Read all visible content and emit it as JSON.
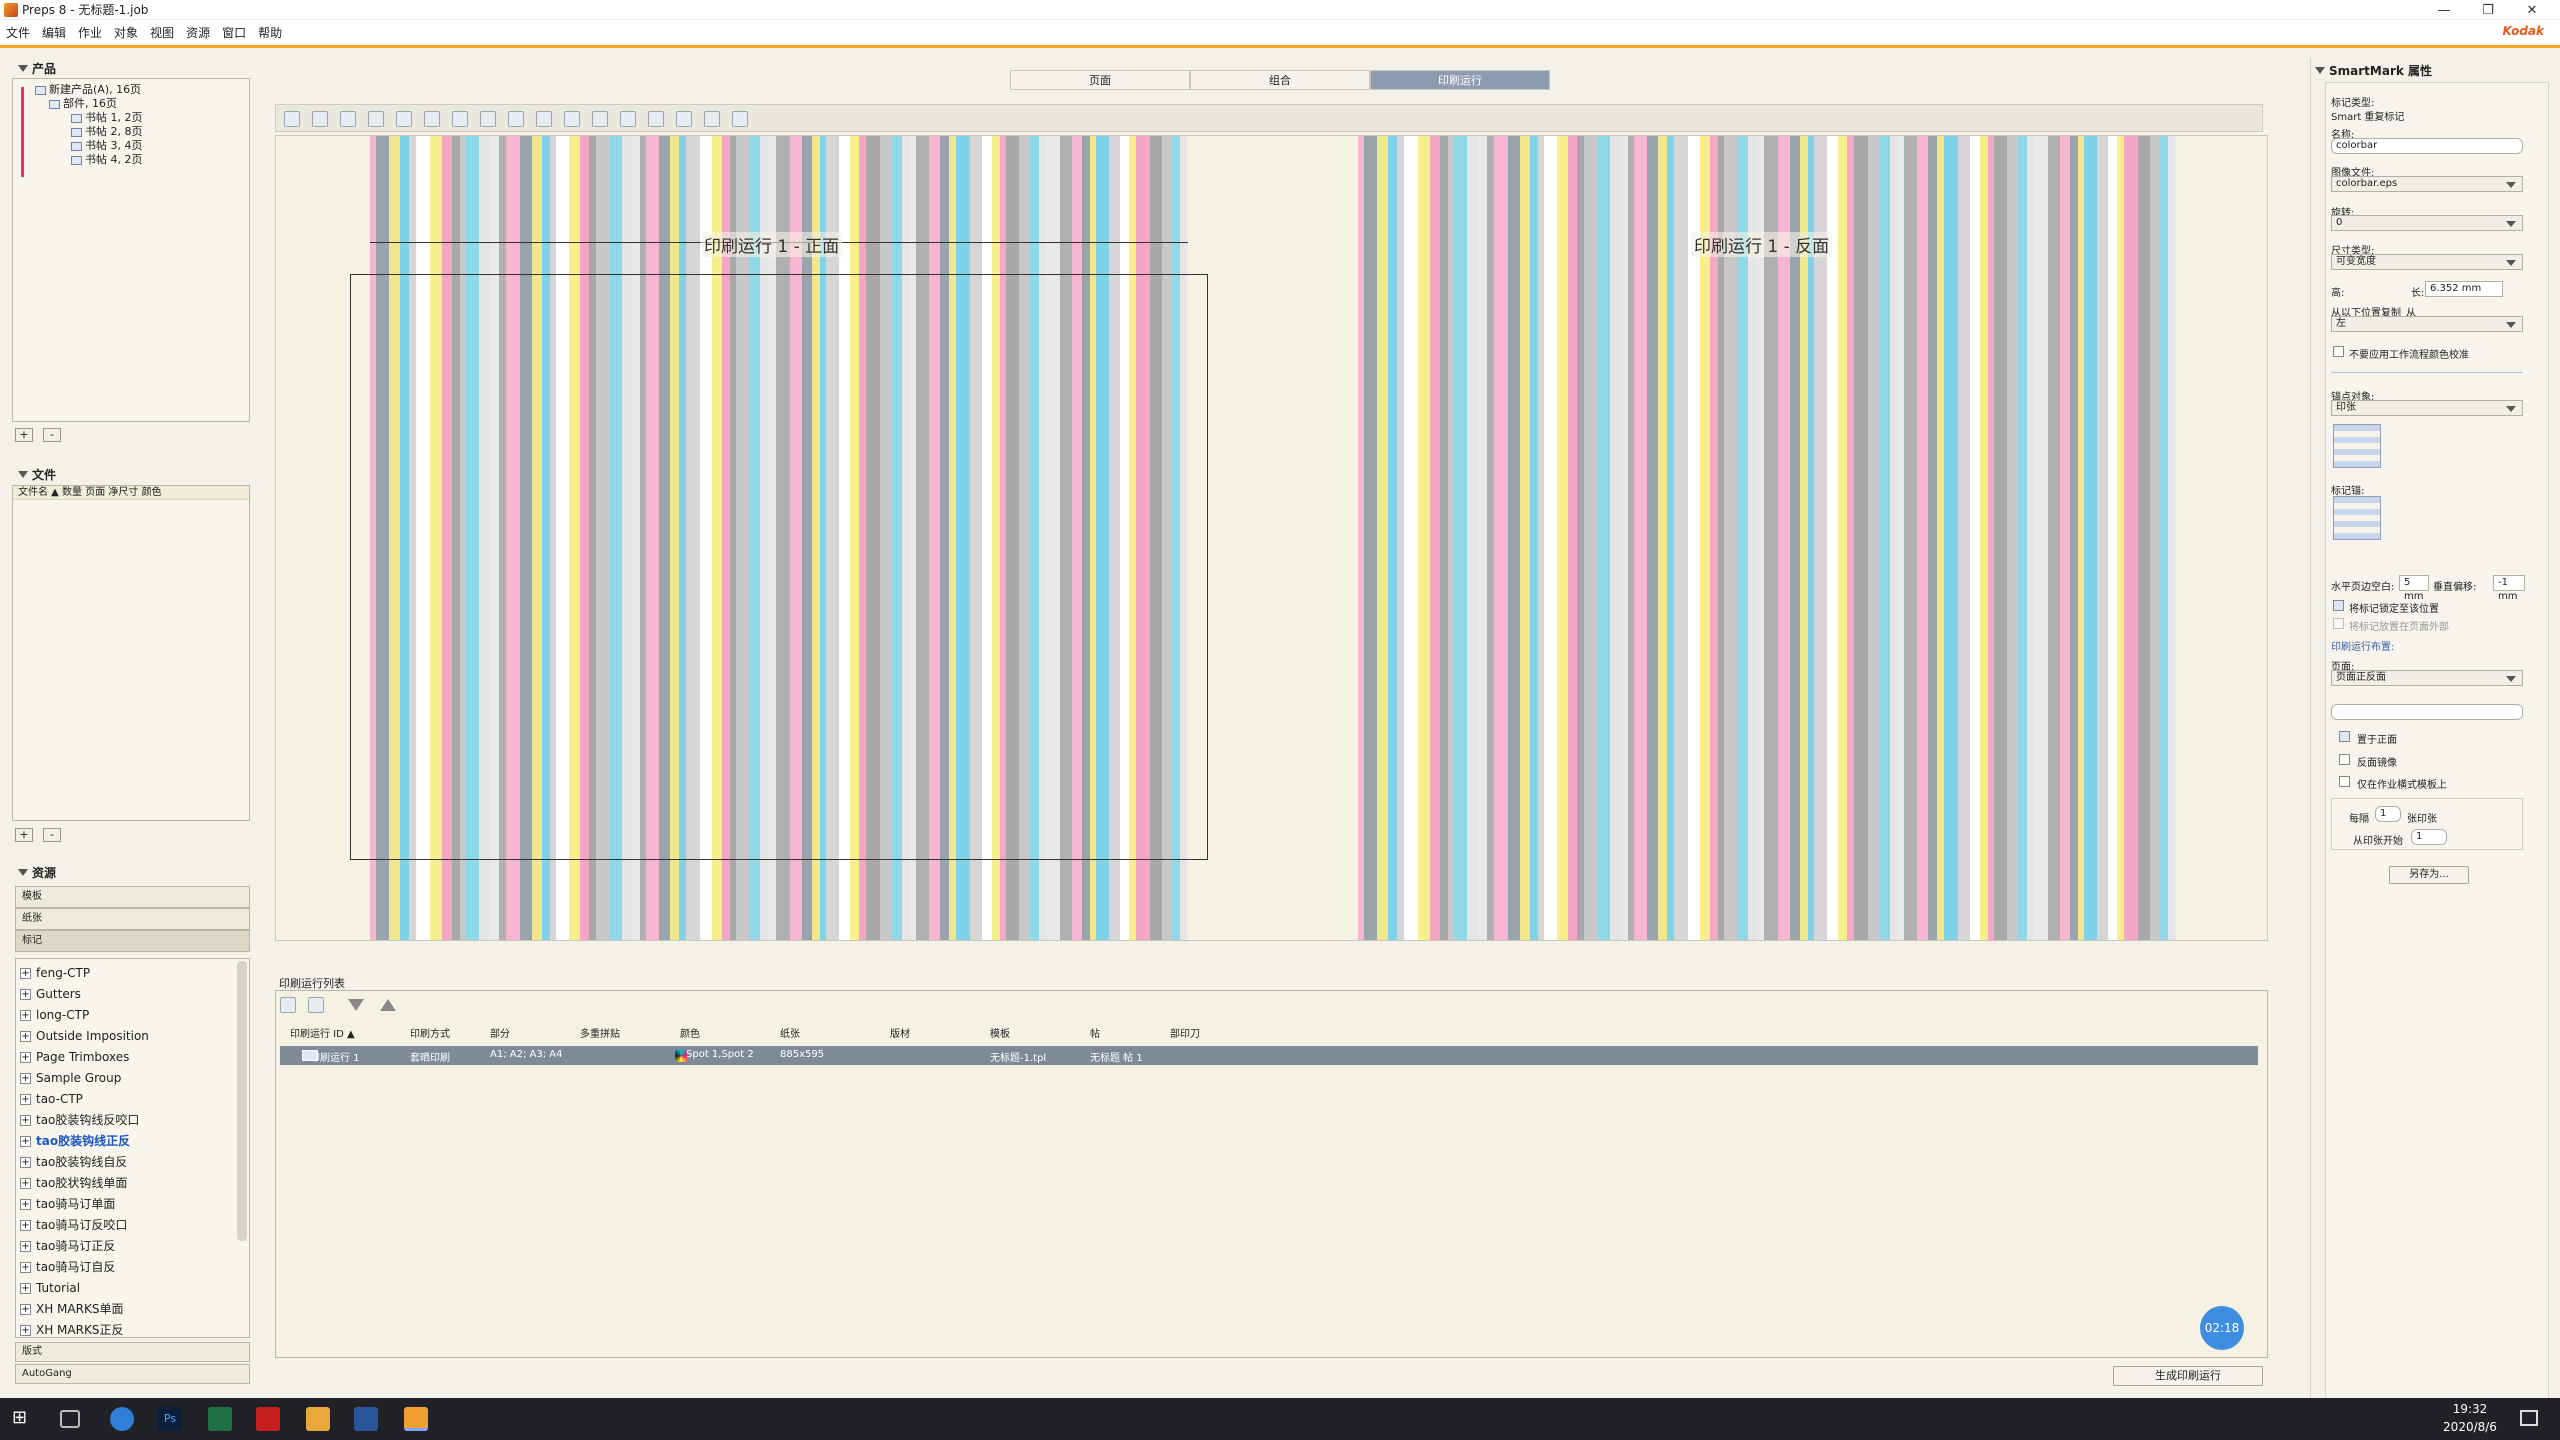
{
  "window": {
    "title": "Preps 8 - 无标题-1.job",
    "brand": "Kodak"
  },
  "menu": [
    "文件",
    "编辑",
    "作业",
    "对象",
    "视图",
    "资源",
    "窗口",
    "帮助"
  ],
  "products": {
    "header": "产品",
    "tree": [
      "新建产品(A), 16页",
      "部件, 16页",
      "书帖 1, 2页",
      "书帖 2, 8页",
      "书帖 3, 4页",
      "书帖 4, 2页"
    ]
  },
  "files": {
    "header": "文件",
    "columns": "文件名 ▲ 数量 页面 净尺寸 颜色"
  },
  "resources": {
    "header": "资源",
    "categories": [
      "模板",
      "纸张",
      "标记"
    ],
    "items": [
      "feng-CTP",
      "Gutters",
      "long-CTP",
      "Outside Imposition",
      "Page Trimboxes",
      "Sample Group",
      "tao-CTP",
      "tao胶装钩线反咬口",
      "tao胶装钩线正反",
      "tao胶装钩线自反",
      "tao胶状钩线单面",
      "tao骑马订单面",
      "tao骑马订反咬口",
      "tao骑马订正反",
      "tao骑马订自反",
      "Tutorial",
      "XH MARKS单面",
      "XH MARKS正反"
    ],
    "bottom": [
      "版式",
      "AutoGang"
    ]
  },
  "tabs": [
    "页面",
    "组合",
    "印刷运行"
  ],
  "canvas": {
    "front_title": "印刷运行 1 - 正面",
    "back_title": "印刷运行 1 - 反面"
  },
  "runlist": {
    "header": "印刷运行列表",
    "columns": [
      "印刷运行 ID ▲",
      "印刷方式",
      "部分",
      "多重拼贴",
      "颜色",
      "纸张",
      "版材",
      "模板",
      "帖",
      "部印刀"
    ],
    "row": [
      "印刷运行 1",
      "套晒印刷",
      "A1; A2; A3; A4",
      "",
      "Spot 1,Spot 2",
      "885x595",
      "",
      "无标题-1.tpl",
      "无标题 帖 1",
      ""
    ],
    "timer": "02:18",
    "generate_button": "生成印刷运行"
  },
  "smartmark": {
    "header": "SmartMark 属性",
    "mark_type_label": "标记类型:",
    "mark_type_value": "Smart 重复标记",
    "name_label": "名称:",
    "name_value": "colorbar",
    "image_file_label": "图像文件:",
    "image_file_value": "colorbar.eps",
    "rotation_label": "旋转:",
    "rotation_value": "0",
    "size_type_label": "尺寸类型:",
    "size_type_value": "可变宽度",
    "height_label": "高:",
    "width_label": "长:",
    "width_value": "6.352 mm",
    "repeat_label": "从以下位置复制_从",
    "repeat_value": "左",
    "no_workflow_check": "不要应用工作流程颜色校准",
    "anchor_label": "锚点对象:",
    "anchor_value": "印张",
    "mark_anchor_label": "标记锚:",
    "h_offset_label": "水平页边空白:",
    "h_offset_value": "5 mm",
    "v_offset_label": "垂直偏移:",
    "v_offset_value": "-1 mm",
    "lock_check": "将标记锁定至该位置",
    "outside_check": "将标记放置在页面外部",
    "layout_label": "印刷运行布置:",
    "page_label": "页面:",
    "page_value": "页面正反面",
    "front_check": "置于正面",
    "mirror_check": "反面镜像",
    "job_check": "仅在作业横式模板上",
    "every_label": "每隔",
    "every_value": "1",
    "every_suffix": "张印张",
    "start_label": "从印张开始",
    "start_value": "1",
    "save_as": "另存为..."
  },
  "taskbar": {
    "time": "19:32",
    "date": "2020/8/6"
  }
}
